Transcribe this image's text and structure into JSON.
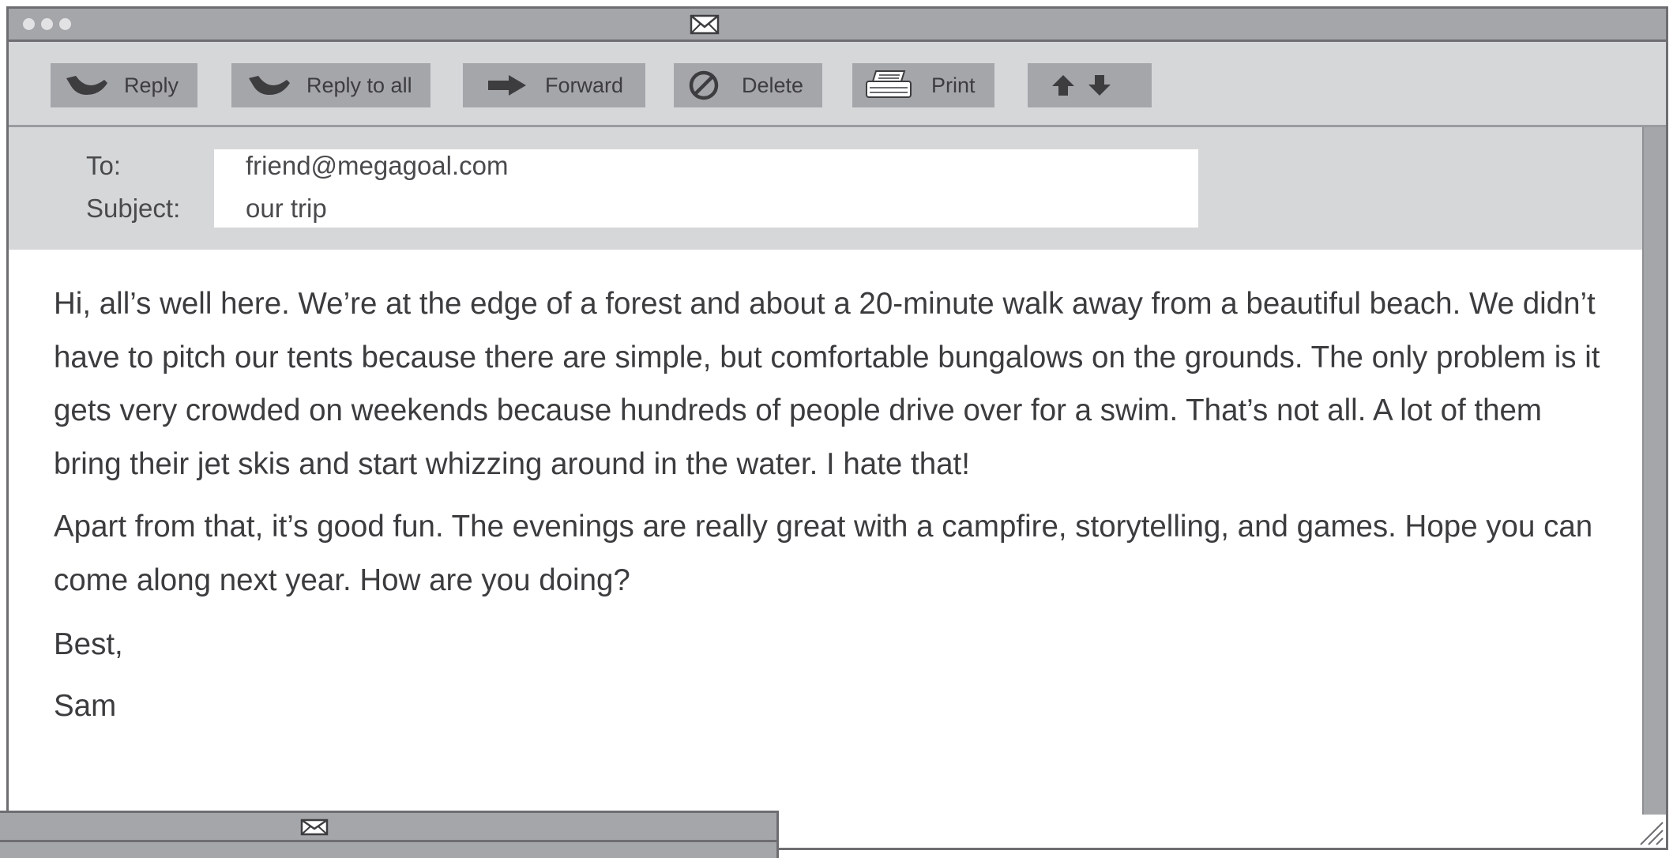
{
  "toolbar": {
    "reply": {
      "label": "Reply",
      "icon": "reply-icon"
    },
    "reply_all": {
      "label": "Reply to all",
      "icon": "reply-all-icon"
    },
    "forward": {
      "label": "Forward",
      "icon": "forward-arrow-icon"
    },
    "delete": {
      "label": "Delete",
      "icon": "no-sign-icon"
    },
    "print": {
      "label": "Print",
      "icon": "printer-icon"
    },
    "navigate": {
      "icons": [
        "arrow-up-icon",
        "arrow-down-icon"
      ]
    }
  },
  "header": {
    "to_label": "To:",
    "to_value": "friend@megagoal.com",
    "subject_label": "Subject:",
    "subject_value": "our trip"
  },
  "message": {
    "paragraph1": "Hi, all’s well here. We’re at the edge of a forest and about a 20-minute walk away from a beautiful beach. We didn’t have to pitch our tents because there are simple, but comfortable bungalows on the grounds. The only problem is it gets very crowded on weekends because hundreds of people drive over for a swim. That’s not all. A lot of them bring their jet skis and start whizzing around in the water. I hate that!",
    "paragraph2": "Apart from that, it’s good fun. The evenings are really great with a campfire, storytelling, and games. Hope you can come along next year. How are you doing?",
    "greeting": "Best,",
    "signature": "Sam"
  },
  "colors": {
    "chrome_dark": "#a5a6aa",
    "chrome_light": "#d6d7d9",
    "border": "#6e6e72",
    "text": "#3c3c3f"
  }
}
